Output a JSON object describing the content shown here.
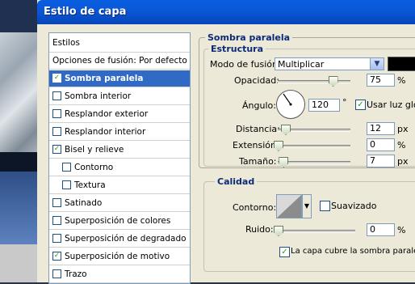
{
  "window": {
    "title": "Estilo de capa"
  },
  "styles_panel": {
    "header": "Estilos",
    "items": [
      {
        "label": "Opciones de fusión: Por defecto",
        "checkbox": false,
        "checked": false,
        "selected": false,
        "indent": false
      },
      {
        "label": "Sombra paralela",
        "checkbox": true,
        "checked": true,
        "selected": true,
        "indent": false
      },
      {
        "label": "Sombra interior",
        "checkbox": true,
        "checked": false,
        "selected": false,
        "indent": false
      },
      {
        "label": "Resplandor exterior",
        "checkbox": true,
        "checked": false,
        "selected": false,
        "indent": false
      },
      {
        "label": "Resplandor interior",
        "checkbox": true,
        "checked": false,
        "selected": false,
        "indent": false
      },
      {
        "label": "Bisel y relieve",
        "checkbox": true,
        "checked": true,
        "selected": false,
        "indent": false
      },
      {
        "label": "Contorno",
        "checkbox": true,
        "checked": false,
        "selected": false,
        "indent": true
      },
      {
        "label": "Textura",
        "checkbox": true,
        "checked": false,
        "selected": false,
        "indent": true
      },
      {
        "label": "Satinado",
        "checkbox": true,
        "checked": false,
        "selected": false,
        "indent": false
      },
      {
        "label": "Superposición de colores",
        "checkbox": true,
        "checked": false,
        "selected": false,
        "indent": false
      },
      {
        "label": "Superposición de degradado",
        "checkbox": true,
        "checked": false,
        "selected": false,
        "indent": false
      },
      {
        "label": "Superposición de motivo",
        "checkbox": true,
        "checked": true,
        "selected": false,
        "indent": false
      },
      {
        "label": "Trazo",
        "checkbox": true,
        "checked": false,
        "selected": false,
        "indent": false
      }
    ]
  },
  "drop_shadow": {
    "section_title": "Sombra paralela",
    "structure": {
      "title": "Estructura",
      "blend_mode_label": "Modo de fusión:",
      "blend_mode_value": "Multiplicar",
      "shadow_color": "#000000",
      "opacity_label": "Opacidad:",
      "opacity_value": "75",
      "opacity_unit": "%",
      "angle_label": "Ángulo:",
      "angle_value": "120",
      "angle_unit": "°",
      "global_light_label": "Usar luz global",
      "global_light_checked": true,
      "distance_label": "Distancia:",
      "distance_value": "12",
      "distance_unit": "px",
      "spread_label": "Extensión:",
      "spread_value": "0",
      "spread_unit": "%",
      "size_label": "Tamaño:",
      "size_value": "7",
      "size_unit": "px"
    },
    "quality": {
      "title": "Calidad",
      "contour_label": "Contorno:",
      "antialias_label": "Suavizado",
      "antialias_checked": false,
      "noise_label": "Ruido:",
      "noise_value": "0",
      "noise_unit": "%",
      "knockout_label": "La capa cubre la sombra paralela",
      "knockout_checked": true
    }
  },
  "colors": {
    "selection": "#316ac5",
    "titlebar": "#0a58d8",
    "group_title": "#0c2a75",
    "dialog_bg": "#ece9d8"
  }
}
